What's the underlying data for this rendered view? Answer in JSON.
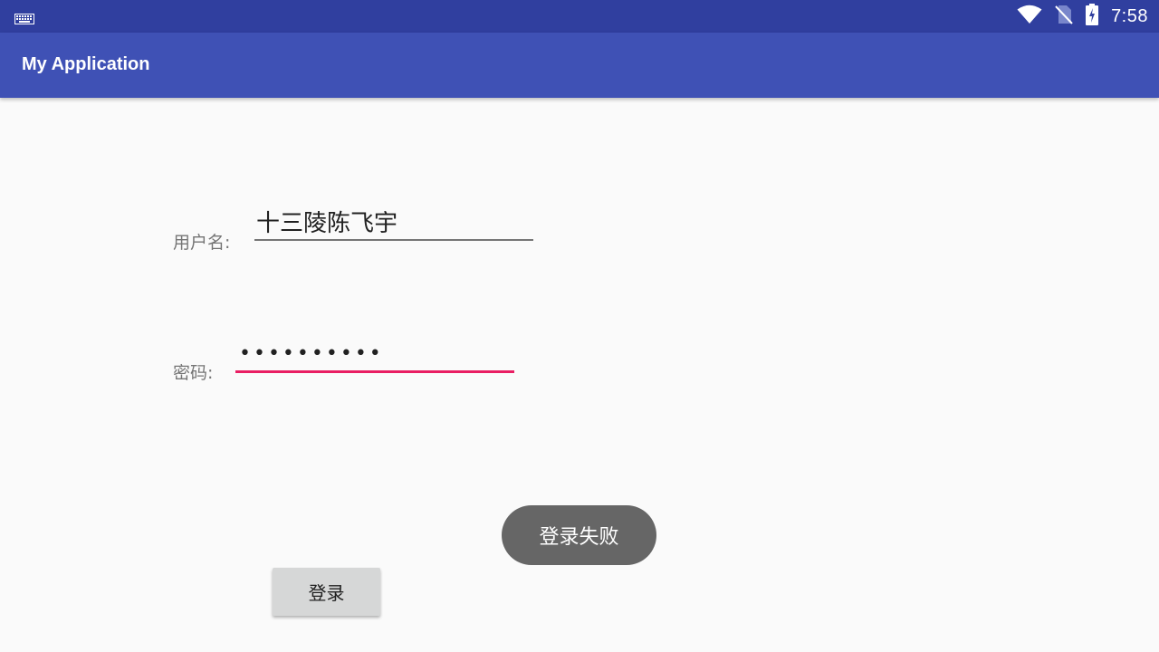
{
  "status_bar": {
    "time": "7:58",
    "icons": [
      "keyboard-icon",
      "wifi-icon",
      "no-sim-icon",
      "battery-charging-icon"
    ],
    "background": "#303f9f"
  },
  "app_bar": {
    "title": "My Application",
    "background": "#3f51b5"
  },
  "form": {
    "username_label": "用户名:",
    "username_value": "十三陵陈飞宇",
    "password_label": "密码:",
    "password_masked": "••••••••••",
    "password_length": 10,
    "accent_color": "#e91e63"
  },
  "login_button": {
    "label": "登录"
  },
  "toast": {
    "message": "登录失败"
  }
}
